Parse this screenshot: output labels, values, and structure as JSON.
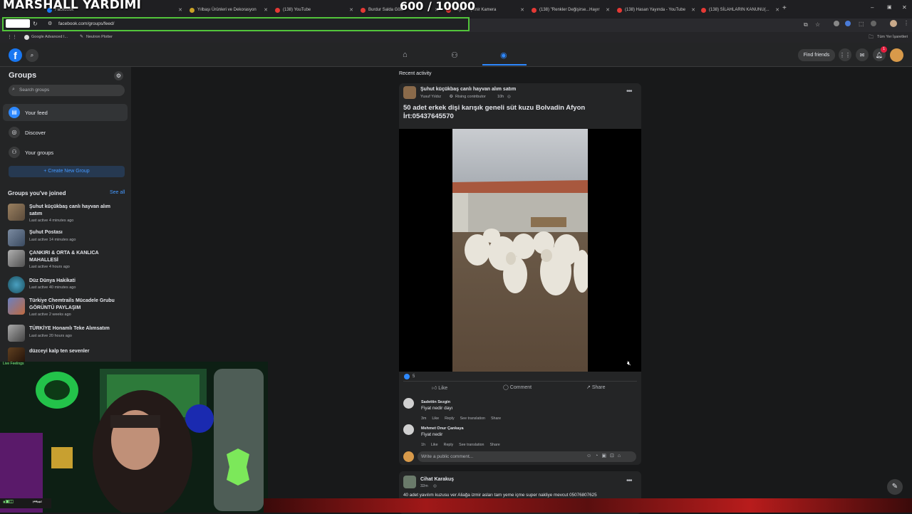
{
  "overlay": {
    "title": "MARSHALL YARDIMI",
    "count": "600  / 10000"
  },
  "browser": {
    "tabs": [
      {
        "label": "Facebook"
      },
      {
        "label": "Yılbaşı Ürünleri ve Dekorasyon"
      },
      {
        "label": "(138) YouTube"
      },
      {
        "label": "Burdur Salda Gölü"
      },
      {
        "label": "Seyret - Şehir Kamera"
      },
      {
        "label": "(138) \"Renkler Değişirse...Hayır"
      },
      {
        "label": "(138) Hasan Yayında - YouTube"
      },
      {
        "label": "(138) SİLAHLARIN KANUNU(..."
      }
    ],
    "url": "facebook.com/groups/feed/",
    "bookmarks": [
      {
        "label": "Google Advanced I..."
      },
      {
        "label": "Neutron Plotter"
      }
    ],
    "all_bookmarks": "Tüm Yer İşaretleri"
  },
  "header": {
    "find_friends": "Find friends",
    "notif_count": "1"
  },
  "sidebar": {
    "title": "Groups",
    "search_placeholder": "Search groups",
    "items": [
      {
        "label": "Your feed"
      },
      {
        "label": "Discover"
      },
      {
        "label": "Your groups"
      }
    ],
    "create_label": "+ Create New Group",
    "joined_title": "Groups you've joined",
    "see_all": "See all",
    "groups": [
      {
        "name": "Şuhut küçükbaş canlı hayvan alım satım",
        "meta": "Last active 4 minutes ago"
      },
      {
        "name": "Şuhut Postası",
        "meta": "Last active 14 minutes ago"
      },
      {
        "name": "ÇANKIRI & ORTA & KANLICA MAHALLESİ",
        "meta": "Last active 4 hours ago"
      },
      {
        "name": "Düz Dünya Hakikati",
        "meta": "Last active 40 minutes ago"
      },
      {
        "name": "Türkiye Chemtrails Mücadele Grubu GÖRÜNTÜ PAYLAŞIM",
        "meta": "Last active 2 weeks ago"
      },
      {
        "name": "TÜRKİYE Honamlı Teke Alımsatım",
        "meta": "Last active 20 hours ago"
      },
      {
        "name": "düzceyi kalp ten sevenler",
        "meta": ""
      }
    ]
  },
  "feed": {
    "recent": "Recent activity",
    "post1": {
      "group": "Şuhut küçükbaş canlı hayvan alım satım",
      "author": "Yusuf Yıldız",
      "badge": "Rising contributor",
      "time": "10h",
      "text": "50 adet erkek dişi karışık geneli süt kuzu Bolvadin Afyon İrt:05437645570",
      "reactions": "5",
      "like": "Like",
      "comment": "Comment",
      "share": "Share",
      "comments": [
        {
          "name": "Sadettin Sezgin",
          "text": "Fiyat nedir dayı",
          "time": "3m",
          "actions": [
            "Like",
            "Reply",
            "See translation",
            "Share"
          ]
        },
        {
          "name": "Mehmet Onur Çankaya",
          "text": "Fiyat nedir",
          "time": "1h",
          "actions": [
            "Like",
            "Reply",
            "See translation",
            "Share"
          ]
        }
      ],
      "write_placeholder": "Write a public comment..."
    },
    "post2": {
      "author": "Cihat Karakuş",
      "time": "32m",
      "text": "40 adet yavılım kuzusu ver Aliağa izmir asları tam yeme içme super nakliye mevcut  05076807625"
    }
  },
  "webcam": {
    "label": "Live Feelings"
  }
}
